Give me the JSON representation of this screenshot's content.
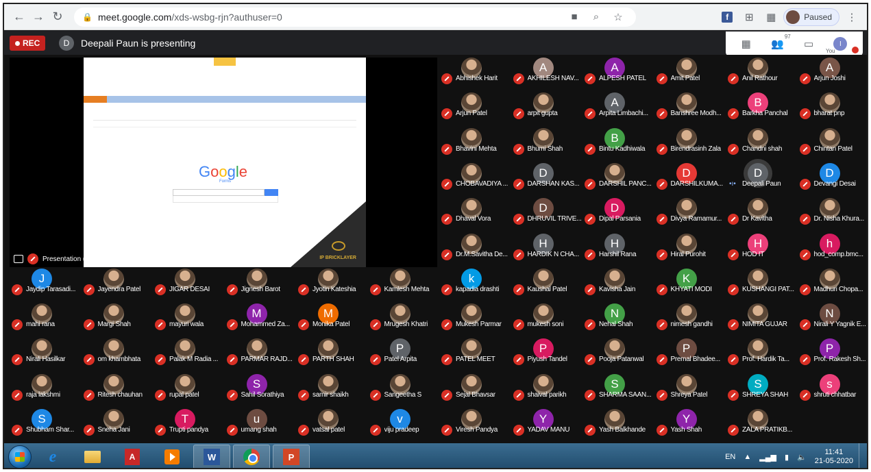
{
  "browser": {
    "url_host": "meet.google.com",
    "url_path": "/xds-wsbg-rjn?authuser=0",
    "profile_label": "Paused",
    "ext_fb": "f"
  },
  "meeting": {
    "rec_label": "REC",
    "presenter_initial": "D",
    "presenting_text": "Deepali Paun is presenting",
    "participant_count": "97",
    "you_label": "You",
    "you_initial": "I",
    "presentation_label": "Presentation (Deepali Paun)"
  },
  "slide": {
    "google_logo": [
      "G",
      "o",
      "o",
      "g",
      "l",
      "e"
    ],
    "google_sub": "Forms",
    "brand": "IP BRICKLAYER"
  },
  "participants": [
    {
      "name": "Abhishek Harit",
      "initial": "",
      "color": "",
      "photo": true
    },
    {
      "name": "AKHILESH NAV...",
      "initial": "A",
      "color": "#a1887f",
      "photo": false
    },
    {
      "name": "ALPESH PATEL",
      "initial": "A",
      "color": "#8e24aa",
      "photo": false
    },
    {
      "name": "Amit Patel",
      "initial": "",
      "color": "",
      "photo": true
    },
    {
      "name": "Anil Rathour",
      "initial": "",
      "color": "",
      "photo": true
    },
    {
      "name": "Arjun Joshi",
      "initial": "A",
      "color": "#795548",
      "photo": false
    },
    {
      "name": "Arjun Patel",
      "initial": "",
      "color": "",
      "photo": true
    },
    {
      "name": "arpit gupta",
      "initial": "",
      "color": "",
      "photo": true
    },
    {
      "name": "Arpita Limbachi...",
      "initial": "A",
      "color": "#5f6368",
      "photo": false
    },
    {
      "name": "Banshree Modh...",
      "initial": "",
      "color": "",
      "photo": true
    },
    {
      "name": "Barkha Panchal",
      "initial": "B",
      "color": "#ec407a",
      "photo": false
    },
    {
      "name": "bharat pnp",
      "initial": "",
      "color": "",
      "photo": true
    },
    {
      "name": "Bhavini Mehta",
      "initial": "",
      "color": "",
      "photo": true
    },
    {
      "name": "Bhumi Shah",
      "initial": "",
      "color": "",
      "photo": true
    },
    {
      "name": "Bintu Kadhiwala",
      "initial": "B",
      "color": "#43a047",
      "photo": false
    },
    {
      "name": "Birendrasinh Zala",
      "initial": "",
      "color": "",
      "photo": true
    },
    {
      "name": "Chandni shah",
      "initial": "",
      "color": "",
      "photo": true
    },
    {
      "name": "Chintan Patel",
      "initial": "",
      "color": "",
      "photo": true
    },
    {
      "name": "CHOBAVADIYA ...",
      "initial": "",
      "color": "",
      "photo": true
    },
    {
      "name": "DARSHAN KAS...",
      "initial": "D",
      "color": "#5f6368",
      "photo": false
    },
    {
      "name": "DARSHIL PANC...",
      "initial": "",
      "color": "",
      "photo": true
    },
    {
      "name": "DARSHILKUMA...",
      "initial": "D",
      "color": "#e53935",
      "photo": false
    },
    {
      "name": "Deepali Paun",
      "initial": "D",
      "color": "#5f6368",
      "photo": false,
      "active": true
    },
    {
      "name": "Devangi Desai",
      "initial": "D",
      "color": "#1e88e5",
      "photo": false
    },
    {
      "name": "Dhaval Vora",
      "initial": "",
      "color": "",
      "photo": true
    },
    {
      "name": "DHRUVIL TRIVE...",
      "initial": "D",
      "color": "#6d4c41",
      "photo": false
    },
    {
      "name": "Dipal Parsania",
      "initial": "D",
      "color": "#d81b60",
      "photo": false
    },
    {
      "name": "Divya Ramamur...",
      "initial": "",
      "color": "",
      "photo": true
    },
    {
      "name": "Dr Kavitha",
      "initial": "",
      "color": "",
      "photo": true
    },
    {
      "name": "Dr. Nisha Khura...",
      "initial": "",
      "color": "",
      "photo": true
    },
    {
      "name": "Dr.M.Savitha De...",
      "initial": "",
      "color": "",
      "photo": true
    },
    {
      "name": "HARDIK N CHA...",
      "initial": "H",
      "color": "#5f6368",
      "photo": false
    },
    {
      "name": "Harshil Rana",
      "initial": "H",
      "color": "#5f6368",
      "photo": false
    },
    {
      "name": "Hiral Purohit",
      "initial": "",
      "color": "",
      "photo": true
    },
    {
      "name": "HOD IT",
      "initial": "H",
      "color": "#ec407a",
      "photo": false
    },
    {
      "name": "hod_comp.bmc...",
      "initial": "h",
      "color": "#d81b60",
      "photo": false
    },
    {
      "name": "Jaydip Tarasadi...",
      "initial": "J",
      "color": "#1e88e5",
      "photo": false
    },
    {
      "name": "Jayendra Patel",
      "initial": "",
      "color": "",
      "photo": true
    },
    {
      "name": "JIGAR DESAI",
      "initial": "",
      "color": "",
      "photo": true
    },
    {
      "name": "Jignesh Barot",
      "initial": "",
      "color": "",
      "photo": true
    },
    {
      "name": "Jyotin Kateshia",
      "initial": "",
      "color": "",
      "photo": true
    },
    {
      "name": "Kamlesh Mehta",
      "initial": "",
      "color": "",
      "photo": true
    },
    {
      "name": "kapadia drashti",
      "initial": "k",
      "color": "#039be5",
      "photo": false
    },
    {
      "name": "Kaushal Patel",
      "initial": "",
      "color": "",
      "photo": true
    },
    {
      "name": "Kavisha Jain",
      "initial": "",
      "color": "",
      "photo": true
    },
    {
      "name": "KHYATI MODI",
      "initial": "K",
      "color": "#43a047",
      "photo": false
    },
    {
      "name": "KUSHANGI PAT...",
      "initial": "",
      "color": "",
      "photo": true
    },
    {
      "name": "Madhuri Chopa...",
      "initial": "",
      "color": "",
      "photo": true
    },
    {
      "name": "mahi rana",
      "initial": "",
      "color": "",
      "photo": true
    },
    {
      "name": "Margi Shah",
      "initial": "",
      "color": "",
      "photo": true
    },
    {
      "name": "mayuri wala",
      "initial": "",
      "color": "",
      "photo": true
    },
    {
      "name": "Mohammed Za...",
      "initial": "M",
      "color": "#8e24aa",
      "photo": false
    },
    {
      "name": "Monika Patel",
      "initial": "M",
      "color": "#ef6c00",
      "photo": false
    },
    {
      "name": "Mrugesh Khatri",
      "initial": "",
      "color": "",
      "photo": true
    },
    {
      "name": "Mukesh Parmar",
      "initial": "",
      "color": "",
      "photo": true
    },
    {
      "name": "mukesh soni",
      "initial": "",
      "color": "",
      "photo": true
    },
    {
      "name": "Nehal Shah",
      "initial": "N",
      "color": "#43a047",
      "photo": false
    },
    {
      "name": "nimesh gandhi",
      "initial": "",
      "color": "",
      "photo": true
    },
    {
      "name": "NIMITA GUJAR",
      "initial": "",
      "color": "",
      "photo": true
    },
    {
      "name": "Nirali Y Yagnik E...",
      "initial": "N",
      "color": "#6d4c41",
      "photo": false
    },
    {
      "name": "Nirali Hasilkar",
      "initial": "",
      "color": "",
      "photo": true
    },
    {
      "name": "om khambhata",
      "initial": "",
      "color": "",
      "photo": true
    },
    {
      "name": "Palak M Radia ...",
      "initial": "",
      "color": "",
      "photo": true
    },
    {
      "name": "PARMAR RAJD...",
      "initial": "",
      "color": "",
      "photo": true
    },
    {
      "name": "PARTH SHAH",
      "initial": "",
      "color": "",
      "photo": true
    },
    {
      "name": "Patel Arpita",
      "initial": "P",
      "color": "#5f6368",
      "photo": false
    },
    {
      "name": "PATEL MEET",
      "initial": "",
      "color": "",
      "photo": true
    },
    {
      "name": "Piyush Tandel",
      "initial": "P",
      "color": "#d81b60",
      "photo": false
    },
    {
      "name": "Pooja Patanwal",
      "initial": "",
      "color": "",
      "photo": true
    },
    {
      "name": "Premal Bhadee...",
      "initial": "P",
      "color": "#6d4c41",
      "photo": false
    },
    {
      "name": "Prof. Hardik Ta...",
      "initial": "",
      "color": "",
      "photo": true
    },
    {
      "name": "Prof. Rakesh Sh...",
      "initial": "P",
      "color": "#8e24aa",
      "photo": false
    },
    {
      "name": "raja lakshmi",
      "initial": "",
      "color": "",
      "photo": true
    },
    {
      "name": "Ritesh chauhan",
      "initial": "",
      "color": "",
      "photo": true
    },
    {
      "name": "rupal patel",
      "initial": "",
      "color": "",
      "photo": true
    },
    {
      "name": "Sahil Sorathiya",
      "initial": "S",
      "color": "#8e24aa",
      "photo": false
    },
    {
      "name": "samir shaikh",
      "initial": "",
      "color": "",
      "photo": true
    },
    {
      "name": "Sangeetha S",
      "initial": "",
      "color": "",
      "photo": true
    },
    {
      "name": "Sejal Bhavsar",
      "initial": "",
      "color": "",
      "photo": true
    },
    {
      "name": "shaival parikh",
      "initial": "",
      "color": "",
      "photo": true
    },
    {
      "name": "SHARMA SAAN...",
      "initial": "S",
      "color": "#43a047",
      "photo": false
    },
    {
      "name": "Shreya Patel",
      "initial": "",
      "color": "",
      "photo": true
    },
    {
      "name": "SHREYA SHAH",
      "initial": "S",
      "color": "#00acc1",
      "photo": false
    },
    {
      "name": "shruti chhatbar",
      "initial": "s",
      "color": "#ec407a",
      "photo": false
    },
    {
      "name": "Shubham Shar...",
      "initial": "S",
      "color": "#1e88e5",
      "photo": false
    },
    {
      "name": "Sneha Jani",
      "initial": "",
      "color": "",
      "photo": true
    },
    {
      "name": "Trupti pandya",
      "initial": "T",
      "color": "#d81b60",
      "photo": false
    },
    {
      "name": "umang shah",
      "initial": "u",
      "color": "#6d4c41",
      "photo": false
    },
    {
      "name": "vatsal patel",
      "initial": "",
      "color": "",
      "photo": true
    },
    {
      "name": "viju pradeep",
      "initial": "v",
      "color": "#1e88e5",
      "photo": false
    },
    {
      "name": "Viresh Pandya",
      "initial": "",
      "color": "",
      "photo": true
    },
    {
      "name": "YADAV MANU",
      "initial": "Y",
      "color": "#8e24aa",
      "photo": false
    },
    {
      "name": "Yash Balkhande",
      "initial": "",
      "color": "",
      "photo": true
    },
    {
      "name": "Yash Shah",
      "initial": "Y",
      "color": "#8e24aa",
      "photo": false
    },
    {
      "name": "ZALA PRATIKB...",
      "initial": "",
      "color": "",
      "photo": true
    }
  ],
  "taskbar": {
    "lang": "EN",
    "time": "11:41",
    "date": "21-05-2020",
    "pdf_label": "A",
    "word_label": "W",
    "ppt_label": "P"
  }
}
